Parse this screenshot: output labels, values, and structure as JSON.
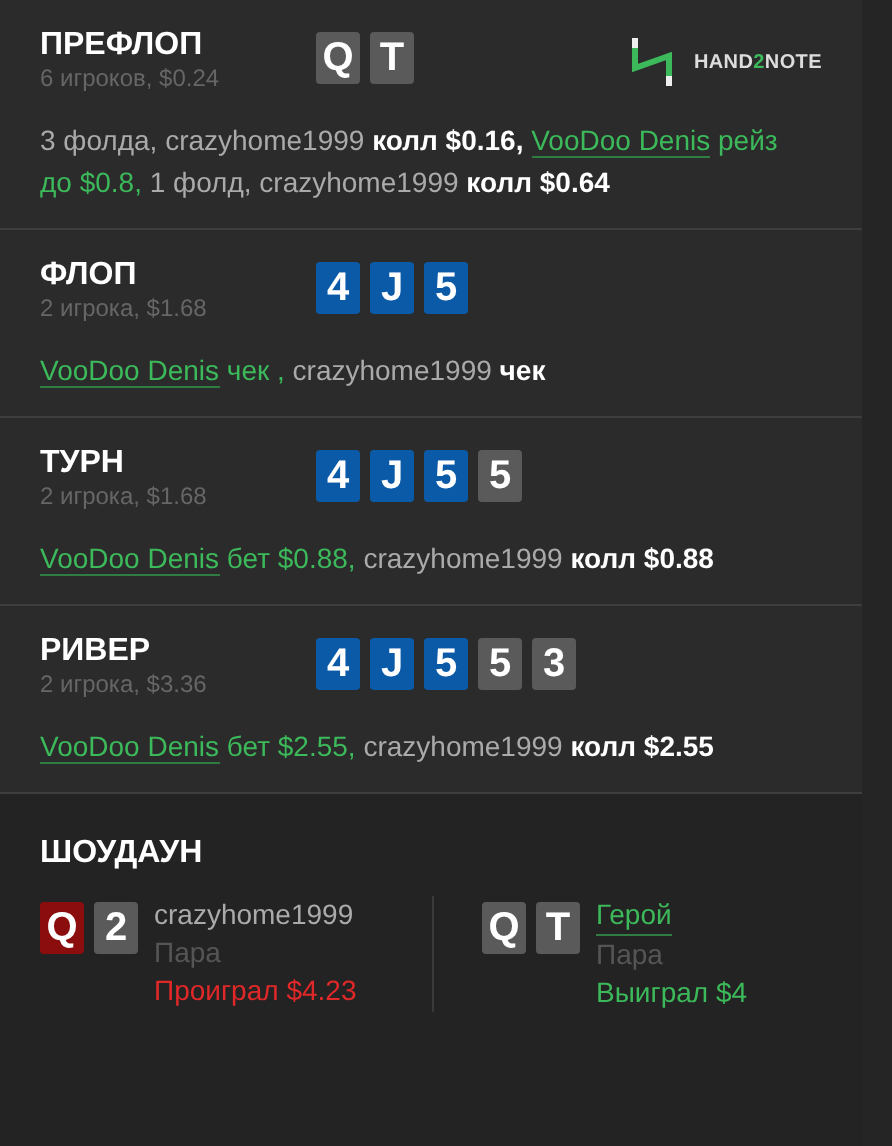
{
  "logo": {
    "before": "HAND",
    "accent": "2",
    "after": "NOTE"
  },
  "streets": [
    {
      "title": "ПРЕФЛОП",
      "subtitle": "6 игроков, $0.24",
      "cards": [
        {
          "rank": "Q",
          "color": "#5a5a5a"
        },
        {
          "rank": "T",
          "color": "#5a5a5a"
        }
      ],
      "actions": [
        {
          "kind": "text",
          "text": "3 фолда, crazyhome1999 "
        },
        {
          "kind": "bold",
          "text": "колл $0.16, "
        },
        {
          "kind": "link",
          "text": "VooDoo Denis"
        },
        {
          "kind": "green",
          "text": " рейз до $0.8, "
        },
        {
          "kind": "text",
          "text": "1 фолд, crazyhome1999 "
        },
        {
          "kind": "bold",
          "text": "колл $0.64"
        }
      ]
    },
    {
      "title": "ФЛОП",
      "subtitle": "2 игрока, $1.68",
      "cards": [
        {
          "rank": "4",
          "color": "#0b5aa8"
        },
        {
          "rank": "J",
          "color": "#0b5aa8"
        },
        {
          "rank": "5",
          "color": "#0b5aa8"
        }
      ],
      "actions": [
        {
          "kind": "link",
          "text": "VooDoo Denis"
        },
        {
          "kind": "green",
          "text": " чек , "
        },
        {
          "kind": "text",
          "text": "crazyhome1999 "
        },
        {
          "kind": "bold",
          "text": "чек"
        }
      ]
    },
    {
      "title": "ТУРН",
      "subtitle": "2 игрока, $1.68",
      "cards": [
        {
          "rank": "4",
          "color": "#0b5aa8"
        },
        {
          "rank": "J",
          "color": "#0b5aa8"
        },
        {
          "rank": "5",
          "color": "#0b5aa8"
        },
        {
          "rank": "5",
          "color": "#5a5a5a"
        }
      ],
      "actions": [
        {
          "kind": "link",
          "text": "VooDoo Denis"
        },
        {
          "kind": "green",
          "text": " бет $0.88, "
        },
        {
          "kind": "text",
          "text": "crazyhome1999 "
        },
        {
          "kind": "bold",
          "text": "колл $0.88"
        }
      ]
    },
    {
      "title": "РИВЕР",
      "subtitle": "2 игрока, $3.36",
      "cards": [
        {
          "rank": "4",
          "color": "#0b5aa8"
        },
        {
          "rank": "J",
          "color": "#0b5aa8"
        },
        {
          "rank": "5",
          "color": "#0b5aa8"
        },
        {
          "rank": "5",
          "color": "#5a5a5a"
        },
        {
          "rank": "3",
          "color": "#5a5a5a"
        }
      ],
      "actions": [
        {
          "kind": "link",
          "text": "VooDoo Denis"
        },
        {
          "kind": "green",
          "text": " бет $2.55, "
        },
        {
          "kind": "text",
          "text": "crazyhome1999 "
        },
        {
          "kind": "bold",
          "text": "колл $2.55"
        }
      ]
    }
  ],
  "showdown": {
    "title": "ШОУДАУН",
    "players": [
      {
        "name": "crazyhome1999",
        "kind": "text",
        "hand": "Пара",
        "result": "Проиграл $4.23",
        "color": "#e02828",
        "cards": [
          {
            "rank": "Q",
            "color": "#8b0d0d"
          },
          {
            "rank": "2",
            "color": "#5a5a5a"
          }
        ]
      },
      {
        "name": "Герой",
        "kind": "link",
        "hand": "Пара",
        "result": "Выиграл $4",
        "color": "#3cb95a",
        "cards": [
          {
            "rank": "Q",
            "color": "#5a5a5a"
          },
          {
            "rank": "T",
            "color": "#5a5a5a"
          }
        ]
      }
    ]
  }
}
